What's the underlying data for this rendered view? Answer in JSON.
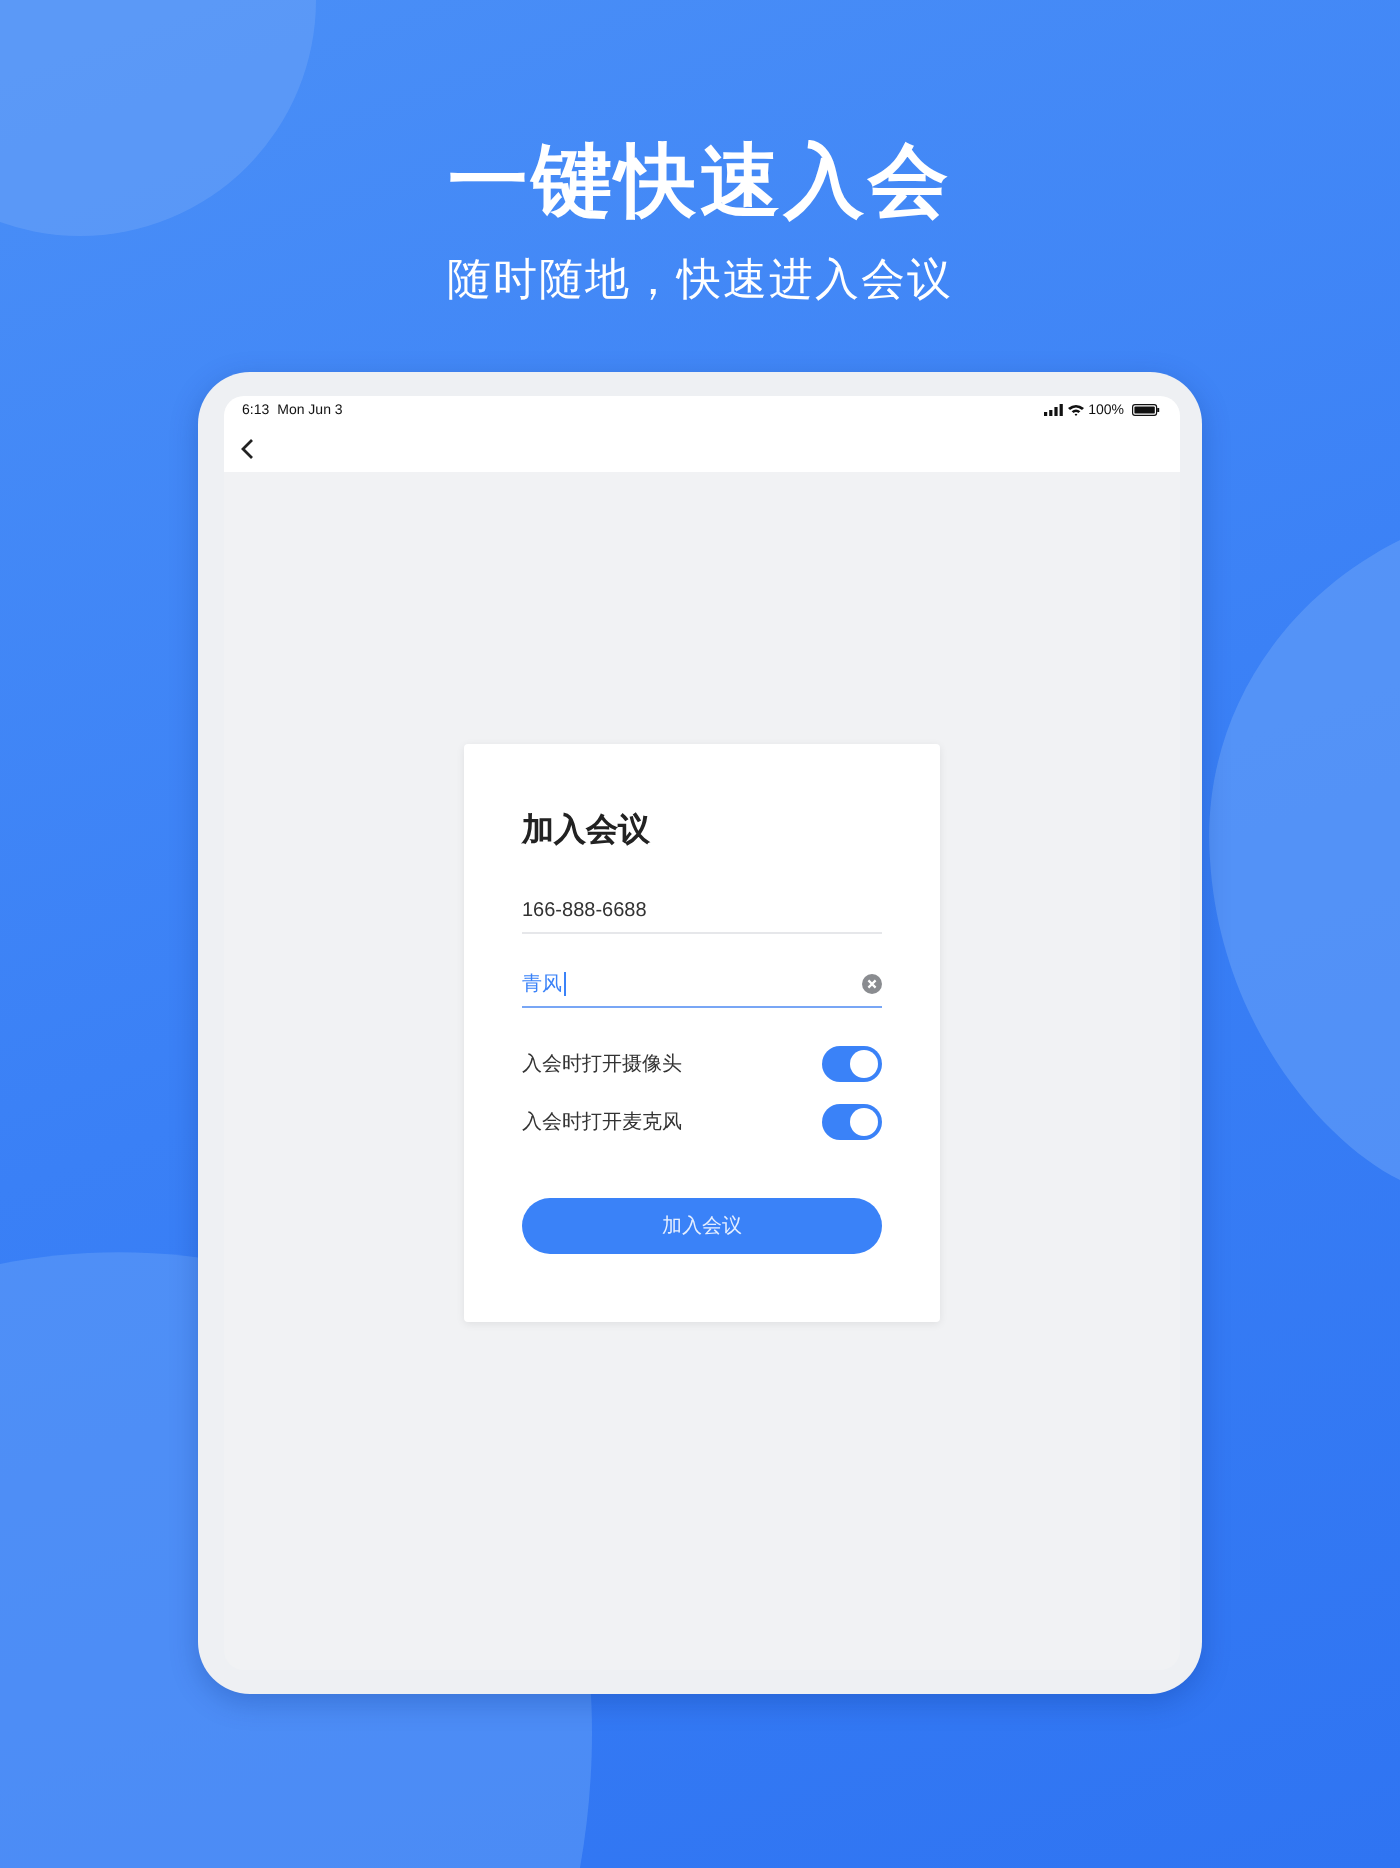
{
  "hero": {
    "title": "一键快速入会",
    "subtitle": "随时随地，快速进入会议"
  },
  "status_bar": {
    "time": "6:13",
    "date": "Mon Jun 3",
    "battery": "100%"
  },
  "join_card": {
    "title": "加入会议",
    "fields": [
      {
        "value": "166-888-6688",
        "focused": false
      },
      {
        "value": "青风",
        "focused": true
      }
    ],
    "options": [
      {
        "label": "入会时打开摄像头",
        "on": true
      },
      {
        "label": "入会时打开麦克风",
        "on": true
      }
    ],
    "button": "加入会议"
  }
}
